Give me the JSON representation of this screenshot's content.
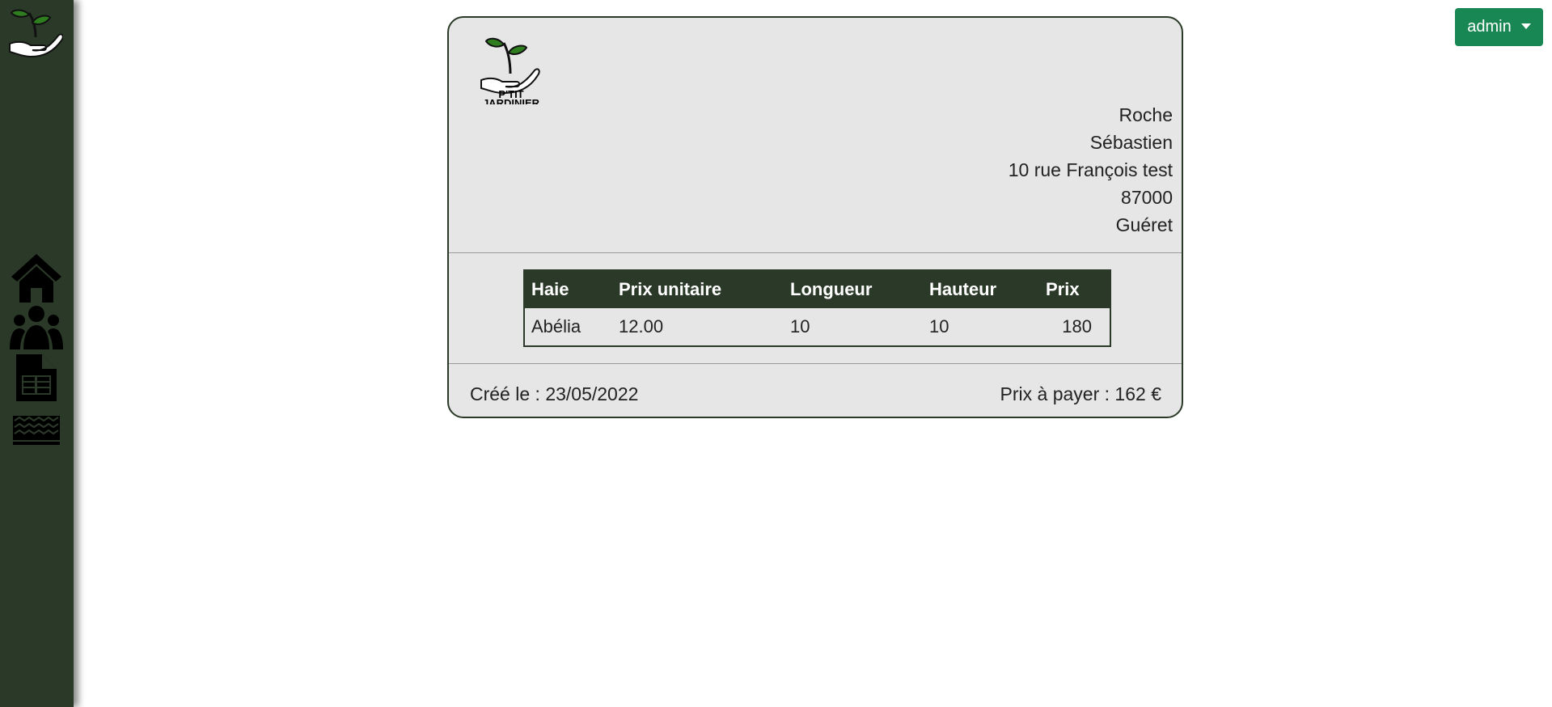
{
  "sidebar": {
    "icons": [
      "plant-in-hand-logo",
      "home-icon",
      "users-icon",
      "document-table-icon",
      "hedge-icon"
    ]
  },
  "user_menu": {
    "label": "admin"
  },
  "invoice": {
    "logo_text_line1": "P'TIT",
    "logo_text_line2": "JARDINIER",
    "client": {
      "last_name": "Roche",
      "first_name": "Sébastien",
      "street": "10 rue François test",
      "postal_code": "87000",
      "city": "Guéret"
    },
    "table": {
      "headers": [
        "Haie",
        "Prix unitaire",
        "Longueur",
        "Hauteur",
        "Prix"
      ],
      "rows": [
        [
          "Abélia",
          "12.00",
          "10",
          "10",
          "180"
        ]
      ]
    },
    "created_label": "Créé le : 23/05/2022",
    "total_label": "Prix à payer : 162 €"
  },
  "colors": {
    "sidebar": "#2b3a28",
    "accent_button": "#198754",
    "card_background": "#e6e6e6",
    "leaf_green": "#2e7d1e"
  }
}
